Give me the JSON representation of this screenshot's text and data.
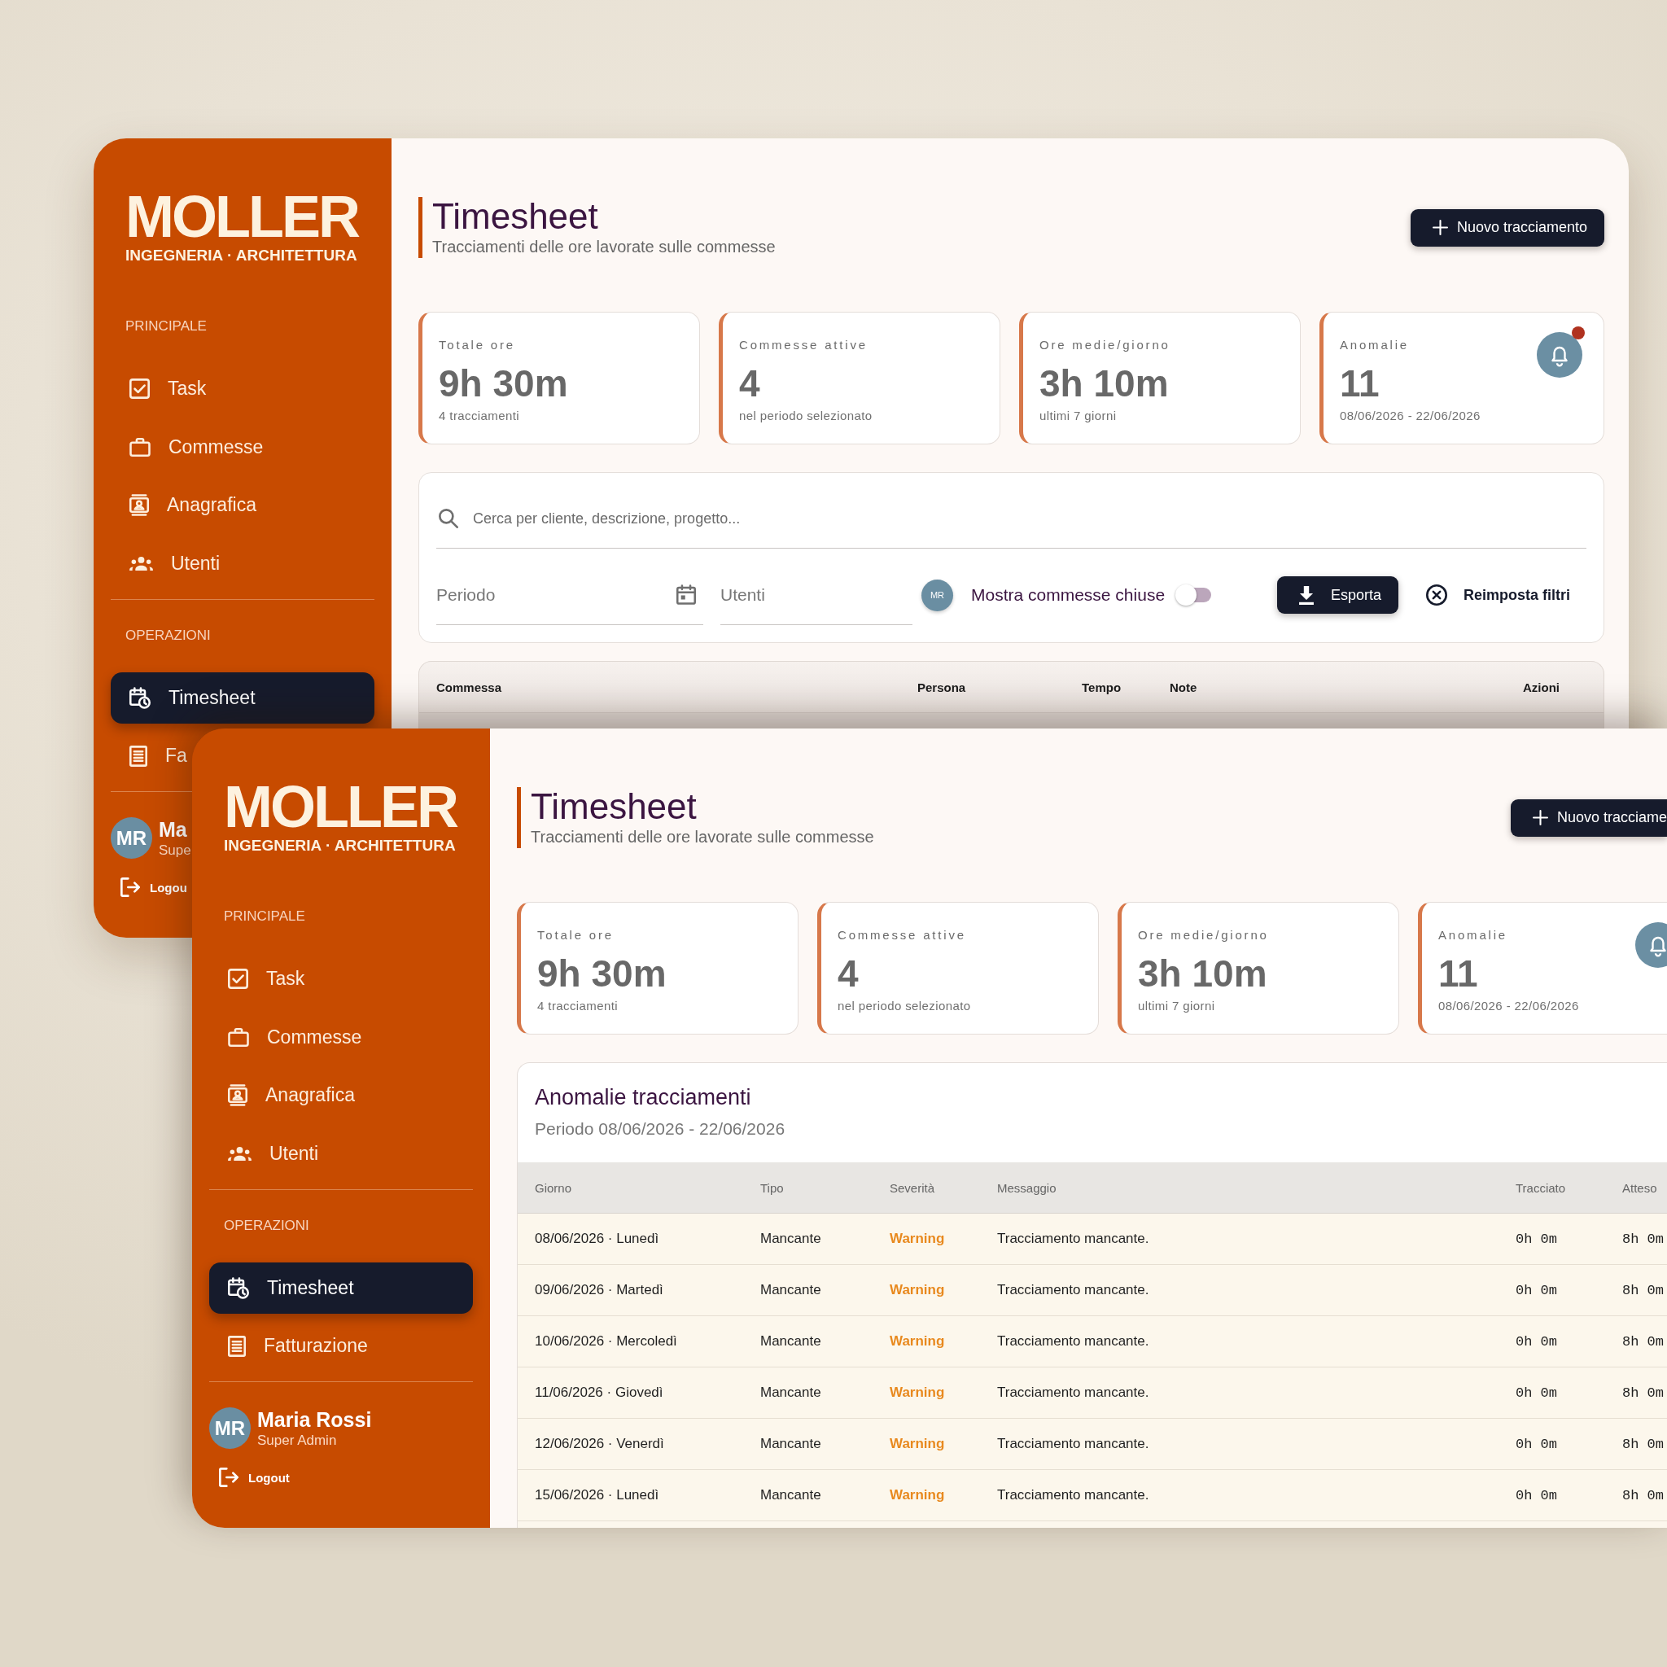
{
  "windows": [
    {
      "sidebar": {
        "logo": {
          "wordmark": "MOLLER",
          "tagline": "INGEGNERIA · ARCHITETTURA"
        },
        "sections": [
          {
            "label": "PRINCIPALE",
            "items": [
              {
                "label": "Task",
                "selected": false
              },
              {
                "label": "Commesse",
                "selected": false
              },
              {
                "label": "Anagrafica",
                "selected": false
              },
              {
                "label": "Utenti",
                "selected": false
              }
            ]
          },
          {
            "label": "OPERAZIONI",
            "items": [
              {
                "label": "Timesheet",
                "selected": true
              },
              {
                "label": "Fa",
                "selected": false
              }
            ]
          }
        ],
        "user": {
          "initials": "MR",
          "name": "Ma",
          "role": "Supe",
          "logout": "Logou"
        }
      },
      "header": {
        "title": "Timesheet",
        "subtitle": "Tracciamenti delle ore lavorate sulle commesse",
        "button": "Nuovo tracciamento"
      },
      "stats": [
        {
          "kind": "metric",
          "label": "Totale ore",
          "value": "9h 30m",
          "note": "4 tracciamenti"
        },
        {
          "kind": "metric",
          "label": "Commesse attive",
          "value": "4",
          "note": "nel periodo selezionato"
        },
        {
          "kind": "metric",
          "label": "Ore medie/giorno",
          "value": "3h 10m",
          "note": "ultimi 7 giorni"
        },
        {
          "kind": "alert",
          "label": "Anomalie",
          "value": "11",
          "note": "08/06/2026 - 22/06/2026",
          "notification": true
        }
      ],
      "filters": {
        "search": {
          "placeholder": "Cerca per cliente, descrizione, progetto..."
        },
        "period": {
          "placeholder": "Periodo"
        },
        "users": {
          "placeholder": "Utenti"
        },
        "user_chip": "MR",
        "toggle": {
          "label": "Mostra commesse chiuse",
          "on": false
        },
        "export_button": "Esporta",
        "reset_button": "Reimposta filtri"
      },
      "table": {
        "columns": [
          "Commessa",
          "Persona",
          "Tempo",
          "Note",
          "Azioni"
        ]
      }
    },
    {
      "sidebar": {
        "logo": {
          "wordmark": "MOLLER",
          "tagline": "INGEGNERIA · ARCHITETTURA"
        },
        "sections": [
          {
            "label": "PRINCIPALE",
            "items": [
              {
                "label": "Task",
                "selected": false
              },
              {
                "label": "Commesse",
                "selected": false
              },
              {
                "label": "Anagrafica",
                "selected": false
              },
              {
                "label": "Utenti",
                "selected": false
              }
            ]
          },
          {
            "label": "OPERAZIONI",
            "items": [
              {
                "label": "Timesheet",
                "selected": true
              },
              {
                "label": "Fatturazione",
                "selected": false
              }
            ]
          }
        ],
        "user": {
          "initials": "MR",
          "name": "Maria Rossi",
          "role": "Super Admin",
          "logout": "Logout"
        }
      },
      "header": {
        "title": "Timesheet",
        "subtitle": "Tracciamenti delle ore lavorate sulle commesse",
        "button": "Nuovo tracciame"
      },
      "stats": [
        {
          "kind": "metric",
          "label": "Totale ore",
          "value": "9h 30m",
          "note": "4 tracciamenti"
        },
        {
          "kind": "metric",
          "label": "Commesse attive",
          "value": "4",
          "note": "nel periodo selezionato"
        },
        {
          "kind": "metric",
          "label": "Ore medie/giorno",
          "value": "3h 10m",
          "note": "ultimi 7 giorni"
        },
        {
          "kind": "alert",
          "label": "Anomalie",
          "value": "11",
          "note": "08/06/2026 - 22/06/2026"
        }
      ],
      "anomalies": {
        "title": "Anomalie tracciamenti",
        "period": "Periodo 08/06/2026 - 22/06/2026",
        "columns": [
          "Giorno",
          "Tipo",
          "Severità",
          "Messaggio",
          "Tracciato",
          "Atteso"
        ],
        "rows": [
          {
            "day": "08/06/2026 · Lunedì",
            "type": "Mancante",
            "severity": "Warning",
            "message": "Tracciamento mancante.",
            "tracked": "0h 0m",
            "expected": "8h 0m"
          },
          {
            "day": "09/06/2026 · Martedì",
            "type": "Mancante",
            "severity": "Warning",
            "message": "Tracciamento mancante.",
            "tracked": "0h 0m",
            "expected": "8h 0m"
          },
          {
            "day": "10/06/2026 · Mercoledì",
            "type": "Mancante",
            "severity": "Warning",
            "message": "Tracciamento mancante.",
            "tracked": "0h 0m",
            "expected": "8h 0m"
          },
          {
            "day": "11/06/2026 · Giovedì",
            "type": "Mancante",
            "severity": "Warning",
            "message": "Tracciamento mancante.",
            "tracked": "0h 0m",
            "expected": "8h 0m"
          },
          {
            "day": "12/06/2026 · Venerdì",
            "type": "Mancante",
            "severity": "Warning",
            "message": "Tracciamento mancante.",
            "tracked": "0h 0m",
            "expected": "8h 0m"
          },
          {
            "day": "15/06/2026 · Lunedì",
            "type": "Mancante",
            "severity": "Warning",
            "message": "Tracciamento mancante.",
            "tracked": "0h 0m",
            "expected": "8h 0m"
          }
        ]
      }
    }
  ]
}
